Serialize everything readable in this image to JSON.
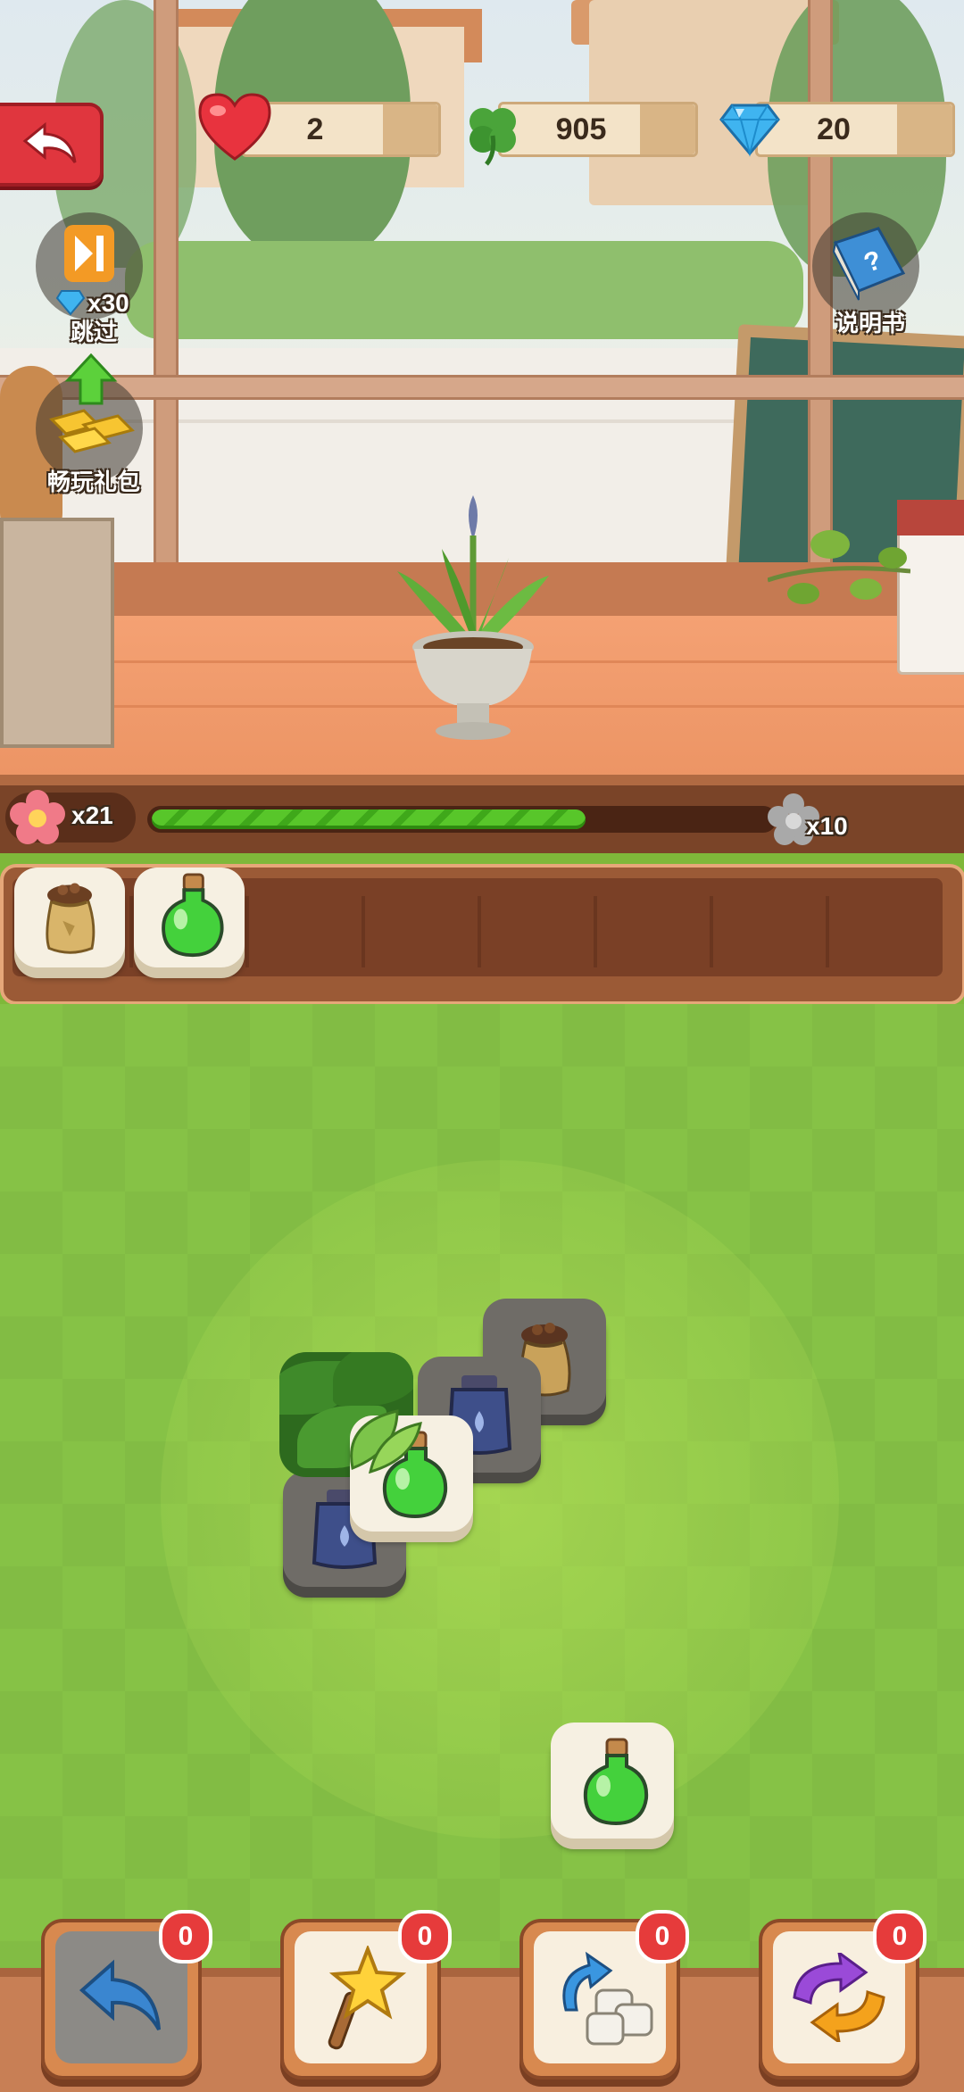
{
  "hud": {
    "hearts": "2",
    "clovers": "905",
    "gems": "20"
  },
  "side": {
    "skip_cost": "x30",
    "skip_label": "跳过",
    "gift_label": "畅玩礼包",
    "manual_label": "说明书"
  },
  "progress": {
    "flowers": "x21",
    "target": "x10",
    "fill_fraction": 0.7
  },
  "tray": {
    "slots": 7,
    "items": [
      "seed-bag",
      "green-potion"
    ]
  },
  "tools": {
    "undo_count": "0",
    "wand_count": "0",
    "shuffle_count": "0",
    "swap_count": "0"
  },
  "colors": {
    "accent_red": "#e0363e",
    "progress_green": "#58c62a",
    "board_green": "#86c246"
  }
}
